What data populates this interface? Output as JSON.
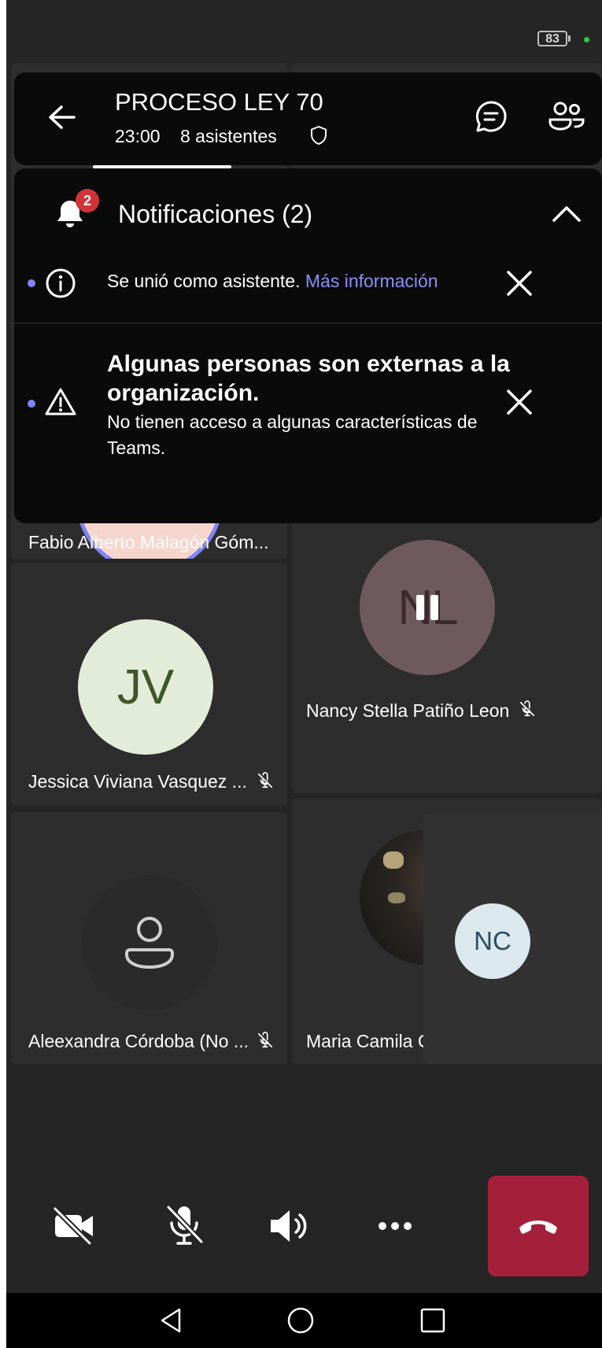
{
  "status_bar": {
    "battery": "83"
  },
  "header": {
    "title": "PROCESO LEY 70",
    "time": "23:00",
    "attendees": "8 asistentes"
  },
  "notifications": {
    "title": "Notificaciones (2)",
    "badge_count": "2",
    "items": [
      {
        "text": "Se unió como asistente.",
        "link": "Más información"
      },
      {
        "title": "Algunas personas son externas a la organización.",
        "body": "No tienen acceso a algunas características de Teams."
      }
    ]
  },
  "participants": [
    {
      "name": "Fabio Alberto Malagón Góm...",
      "initials": "",
      "muted": false
    },
    {
      "name": "Nancy Stella Patiño Leon",
      "initials": "NL",
      "muted": true,
      "paused": true
    },
    {
      "name": "Jessica Viviana Vasquez ...",
      "initials": "JV",
      "muted": true
    },
    {
      "name": "Aleexandra Córdoba (No ...",
      "initials": "",
      "muted": true
    },
    {
      "name": "Maria Camila C",
      "initials": "",
      "muted": false
    },
    {
      "name": "",
      "initials": "NC",
      "muted": false
    }
  ],
  "colors": {
    "accent": "#7f85f5",
    "hangup": "#a4203a",
    "badge": "#d13438",
    "avatar_jv": "#e3ecd8",
    "avatar_nl": "#6e5a5e",
    "avatar_nc": "#dbe8ed"
  },
  "icons": {
    "back": "arrow-left-icon",
    "chat": "chat-icon",
    "people": "people-icon",
    "camera_off": "camera-off-icon",
    "mic_off": "mic-off-icon",
    "speaker": "speaker-icon",
    "more": "more-icon",
    "hangup": "phone-hangup-icon"
  }
}
